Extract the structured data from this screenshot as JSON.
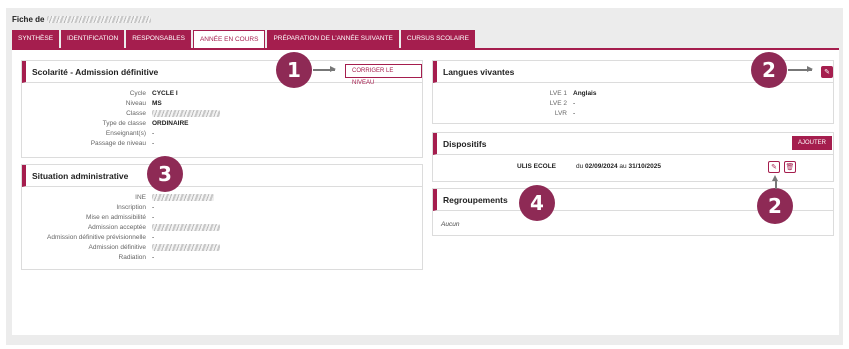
{
  "page": {
    "fiche_label": "Fiche de"
  },
  "tabs": [
    {
      "label": "Synthèse",
      "active": false
    },
    {
      "label": "Identification",
      "active": false
    },
    {
      "label": "Responsables",
      "active": false
    },
    {
      "label": "Année en cours",
      "active": true
    },
    {
      "label": "Préparation de l'année suivante",
      "active": false
    },
    {
      "label": "Cursus scolaire",
      "active": false
    }
  ],
  "scolarite": {
    "title": "Scolarité - Admission définitive",
    "action_label": "CORRIGER LE NIVEAU",
    "rows": [
      {
        "key": "Cycle",
        "value": "CYCLE I"
      },
      {
        "key": "Niveau",
        "value": "MS"
      },
      {
        "key": "Classe",
        "value": ""
      },
      {
        "key": "Type de classe",
        "value": "ORDINAIRE"
      },
      {
        "key": "Enseignant(s)",
        "value": "-"
      },
      {
        "key": "Passage de niveau",
        "value": "-"
      }
    ]
  },
  "situation": {
    "title": "Situation administrative",
    "rows": [
      {
        "key": "INE",
        "value": ""
      },
      {
        "key": "Inscription",
        "value": "-"
      },
      {
        "key": "Mise en admissibilité",
        "value": "-"
      },
      {
        "key": "Admission acceptée",
        "value": ""
      },
      {
        "key": "Admission définitive prévisionnelle",
        "value": "-"
      },
      {
        "key": "Admission définitive",
        "value": ""
      },
      {
        "key": "Radiation",
        "value": "-"
      }
    ]
  },
  "langues": {
    "title": "Langues vivantes",
    "rows": [
      {
        "key": "LVE 1",
        "value": "Anglais"
      },
      {
        "key": "LVE 2",
        "value": "-"
      },
      {
        "key": "LVR",
        "value": "-"
      }
    ]
  },
  "dispositifs": {
    "title": "Dispositifs",
    "add_label": "AJOUTER",
    "item_name": "ULIS ECOLE",
    "item_du": "du",
    "item_start": "02/09/2024",
    "item_au": "au",
    "item_end": "31/10/2025"
  },
  "regroupements": {
    "title": "Regroupements",
    "value": "Aucun"
  },
  "markers": [
    "1",
    "2",
    "2",
    "3",
    "4"
  ],
  "icons": {
    "edit": "pencil-icon",
    "delete": "trash-icon"
  },
  "colors": {
    "accent": "#a51e4e",
    "marker": "#8e2a55"
  }
}
